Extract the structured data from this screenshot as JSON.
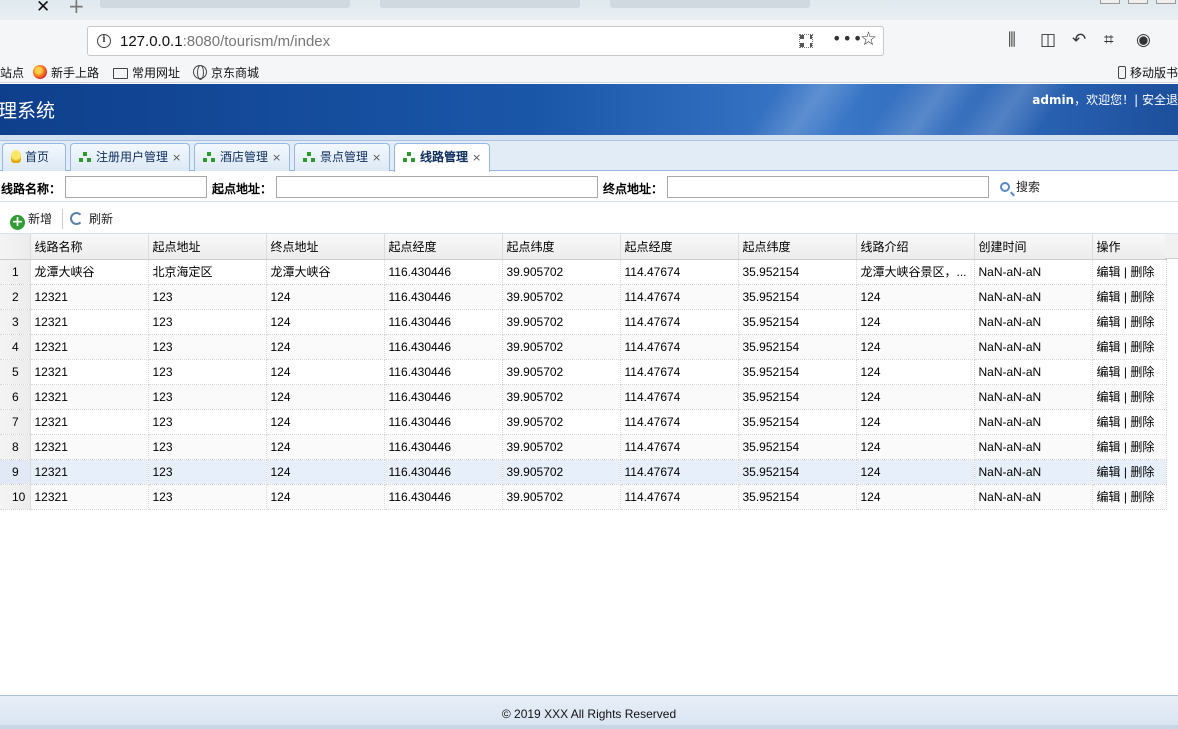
{
  "browser": {
    "url_host": "127.0.0.1",
    "url_rest": ":8080/tourism/m/index",
    "bookmarks": [
      {
        "label": "站点"
      },
      {
        "label": "新手上路"
      },
      {
        "label": "常用网址"
      },
      {
        "label": "京东商城"
      },
      {
        "label": "移动版书"
      }
    ]
  },
  "header": {
    "title": "理系统",
    "user": "admin",
    "greeting": "，欢迎您！|",
    "link": "安全退"
  },
  "tabs": [
    {
      "label": "首页",
      "icon": "lightbulb-icon",
      "closable": false
    },
    {
      "label": "注册用户管理",
      "icon": "tree-icon",
      "closable": true
    },
    {
      "label": "酒店管理",
      "icon": "tree-icon",
      "closable": true
    },
    {
      "label": "景点管理",
      "icon": "tree-icon",
      "closable": true
    },
    {
      "label": "线路管理",
      "icon": "tree-icon",
      "closable": true,
      "active": true
    }
  ],
  "tab_close_glyph": "×",
  "search": {
    "name_label": "线路名称：",
    "start_label": "起点地址：",
    "end_label": "终点地址：",
    "name_value": "",
    "start_value": "",
    "end_value": "",
    "button": "搜索"
  },
  "toolbar": {
    "add": "新增",
    "refresh": "刷新"
  },
  "grid": {
    "columns": [
      "线路名称",
      "起点地址",
      "终点地址",
      "起点经度",
      "起点纬度",
      "起点经度",
      "起点纬度",
      "线路介绍",
      "创建时间",
      "操作"
    ],
    "rows": [
      {
        "no": "1",
        "cells": [
          "龙潭大峡谷",
          "北京海定区",
          "龙潭大峡谷",
          "116.430446",
          "39.905702",
          "114.47674",
          "35.952154",
          "龙潭大峡谷景区，...",
          "NaN-aN-aN"
        ]
      },
      {
        "no": "2",
        "cells": [
          "12321",
          "123",
          "124",
          "116.430446",
          "39.905702",
          "114.47674",
          "35.952154",
          "124",
          "NaN-aN-aN"
        ]
      },
      {
        "no": "3",
        "cells": [
          "12321",
          "123",
          "124",
          "116.430446",
          "39.905702",
          "114.47674",
          "35.952154",
          "124",
          "NaN-aN-aN"
        ]
      },
      {
        "no": "4",
        "cells": [
          "12321",
          "123",
          "124",
          "116.430446",
          "39.905702",
          "114.47674",
          "35.952154",
          "124",
          "NaN-aN-aN"
        ]
      },
      {
        "no": "5",
        "cells": [
          "12321",
          "123",
          "124",
          "116.430446",
          "39.905702",
          "114.47674",
          "35.952154",
          "124",
          "NaN-aN-aN"
        ]
      },
      {
        "no": "6",
        "cells": [
          "12321",
          "123",
          "124",
          "116.430446",
          "39.905702",
          "114.47674",
          "35.952154",
          "124",
          "NaN-aN-aN"
        ]
      },
      {
        "no": "7",
        "cells": [
          "12321",
          "123",
          "124",
          "116.430446",
          "39.905702",
          "114.47674",
          "35.952154",
          "124",
          "NaN-aN-aN"
        ]
      },
      {
        "no": "8",
        "cells": [
          "12321",
          "123",
          "124",
          "116.430446",
          "39.905702",
          "114.47674",
          "35.952154",
          "124",
          "NaN-aN-aN"
        ]
      },
      {
        "no": "9",
        "cells": [
          "12321",
          "123",
          "124",
          "116.430446",
          "39.905702",
          "114.47674",
          "35.952154",
          "124",
          "NaN-aN-aN"
        ]
      },
      {
        "no": "10",
        "cells": [
          "12321",
          "123",
          "124",
          "116.430446",
          "39.905702",
          "114.47674",
          "35.952154",
          "124",
          "NaN-aN-aN"
        ]
      }
    ],
    "edit_label": "编辑",
    "op_separator": " | ",
    "delete_label": "删除"
  },
  "footer": {
    "text": "© 2019 XXX All Rights Reserved"
  }
}
